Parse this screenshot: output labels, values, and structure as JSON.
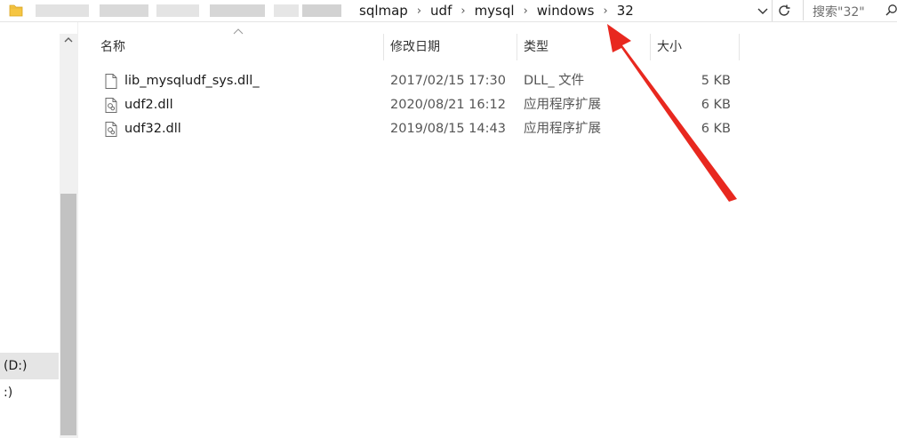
{
  "address": {
    "crumbs": [
      "sqlmap",
      "udf",
      "mysql",
      "windows",
      "32"
    ],
    "separator": "›"
  },
  "search": {
    "placeholder": "搜索\"32\""
  },
  "nav": {
    "items": [
      "(D:)",
      ":)"
    ]
  },
  "columns": {
    "name": "名称",
    "date": "修改日期",
    "type": "类型",
    "size": "大小"
  },
  "files": [
    {
      "name": "lib_mysqludf_sys.dll_",
      "date": "2017/02/15 17:30",
      "type": "DLL_ 文件",
      "size": "5 KB",
      "icon": "blank-file-icon"
    },
    {
      "name": "udf2.dll",
      "date": "2020/08/21 16:12",
      "type": "应用程序扩展",
      "size": "6 KB",
      "icon": "dll-file-icon"
    },
    {
      "name": "udf32.dll",
      "date": "2019/08/15 14:43",
      "type": "应用程序扩展",
      "size": "6 KB",
      "icon": "dll-file-icon"
    }
  ],
  "annotation": {
    "color": "#e8281f",
    "icon": "red-arrow-pointing-to-current-folder"
  },
  "colors": {
    "selection": "#e5e5e5",
    "scrollbar_thumb": "#c2c2c2",
    "folder": "#f5c542"
  }
}
